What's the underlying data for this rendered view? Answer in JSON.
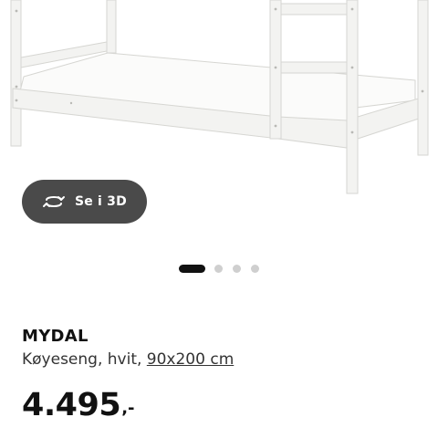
{
  "gallery": {
    "view_3d_label": "Se i 3D",
    "slide_count": 4,
    "active_slide": 1
  },
  "product": {
    "name": "MYDAL",
    "description": "Køyeseng, hvit, ",
    "size_link": "90x200 cm",
    "price_amount": "4.495",
    "price_suffix": ",-"
  },
  "colors": {
    "view_3d_button_bg": "#4a4a4a",
    "active_dot": "#111111",
    "inactive_dot": "#cfcfcf"
  }
}
